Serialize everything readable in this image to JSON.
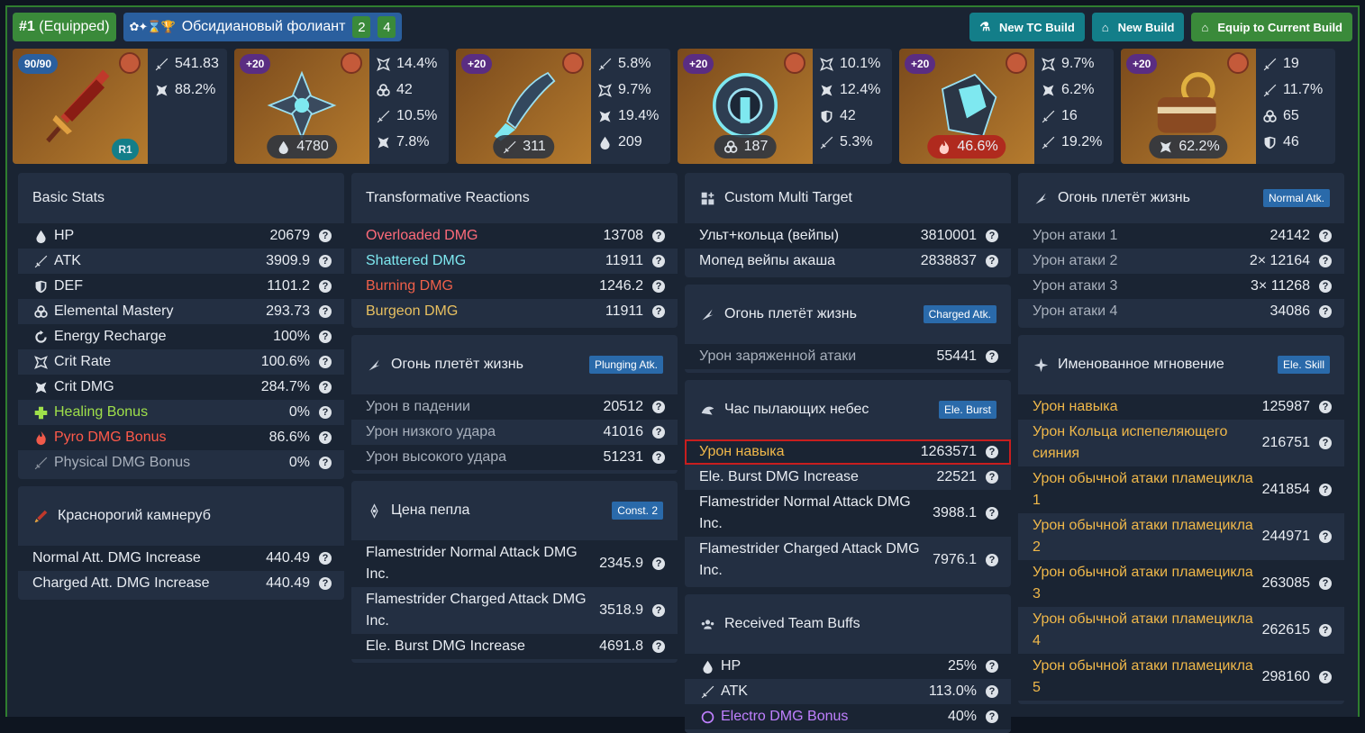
{
  "top": {
    "equip_num": "#1",
    "equip_label": "(Equipped)",
    "set_name": "Обсидиановый фолиант",
    "set_count_a": "2",
    "set_count_b": "4",
    "buttons": [
      "New TC Build",
      "New Build",
      "Equip to Current Build"
    ]
  },
  "items": [
    {
      "level": "90/90",
      "refine": "R1",
      "stats": [
        {
          "icon": "sword-icon",
          "val": "541.83"
        },
        {
          "icon": "crit-dmg-icon",
          "val": "88.2%"
        }
      ]
    },
    {
      "level": "+20",
      "main_icon": "hp-icon",
      "main": "4780",
      "stats": [
        {
          "icon": "crit-rate-icon",
          "val": "14.4%"
        },
        {
          "icon": "em-icon",
          "val": "42"
        },
        {
          "icon": "sword-icon",
          "val": "10.5%"
        },
        {
          "icon": "crit-dmg-icon",
          "val": "7.8%"
        }
      ]
    },
    {
      "level": "+20",
      "main_icon": "sword-icon",
      "main": "311",
      "stats": [
        {
          "icon": "sword-icon",
          "val": "5.8%"
        },
        {
          "icon": "crit-rate-icon",
          "val": "9.7%"
        },
        {
          "icon": "crit-dmg-icon",
          "val": "19.4%"
        },
        {
          "icon": "hp-icon",
          "val": "209"
        }
      ]
    },
    {
      "level": "+20",
      "main_icon": "em-icon",
      "main": "187",
      "stats": [
        {
          "icon": "crit-rate-icon",
          "val": "10.1%"
        },
        {
          "icon": "crit-dmg-icon",
          "val": "12.4%"
        },
        {
          "icon": "shield-icon",
          "val": "42"
        },
        {
          "icon": "sword-icon",
          "val": "5.3%"
        }
      ]
    },
    {
      "level": "+20",
      "main_icon": "pyro-icon",
      "main": "46.6%",
      "stats": [
        {
          "icon": "crit-rate-icon",
          "val": "9.7%"
        },
        {
          "icon": "crit-dmg-icon",
          "val": "6.2%"
        },
        {
          "icon": "sword-icon",
          "val": "16"
        },
        {
          "icon": "sword-icon",
          "val": "19.2%"
        }
      ]
    },
    {
      "level": "+20",
      "main_icon": "crit-dmg-icon",
      "main": "62.2%",
      "stats": [
        {
          "icon": "sword-icon",
          "val": "19"
        },
        {
          "icon": "sword-icon",
          "val": "11.7%"
        },
        {
          "icon": "em-icon",
          "val": "65"
        },
        {
          "icon": "shield-icon",
          "val": "46"
        }
      ]
    }
  ],
  "basic": {
    "title": "Basic Stats",
    "rows": [
      {
        "label": "HP",
        "value": "20679"
      },
      {
        "label": "ATK",
        "value": "3909.9"
      },
      {
        "label": "DEF",
        "value": "1101.2"
      },
      {
        "label": "Elemental Mastery",
        "value": "293.73"
      },
      {
        "label": "Energy Recharge",
        "value": "100%"
      },
      {
        "label": "Crit Rate",
        "value": "100.6%"
      },
      {
        "label": "Crit DMG",
        "value": "284.7%"
      },
      {
        "label": "Healing Bonus",
        "value": "0%"
      },
      {
        "label": "Pyro DMG Bonus",
        "value": "86.6%"
      },
      {
        "label": "Physical DMG Bonus",
        "value": "0%"
      }
    ]
  },
  "weapon_card": {
    "title": "Краснорогий камнеруб",
    "rows": [
      {
        "label": "Normal Att. DMG Increase",
        "value": "440.49"
      },
      {
        "label": "Charged Att. DMG Increase",
        "value": "440.49"
      }
    ]
  },
  "transform": {
    "title": "Transformative Reactions",
    "rows": [
      {
        "label": "Overloaded DMG",
        "value": "13708",
        "color": "#ff6b7a"
      },
      {
        "label": "Shattered DMG",
        "value": "11911",
        "color": "#7ee8f0"
      },
      {
        "label": "Burning DMG",
        "value": "1246.2",
        "color": "#f0604a"
      },
      {
        "label": "Burgeon DMG",
        "value": "11911",
        "color": "#e8c060"
      }
    ]
  },
  "plunge": {
    "title": "Огонь плетёт жизнь",
    "badge": "Plunging Atk.",
    "rows": [
      {
        "label": "Урон в падении",
        "value": "20512"
      },
      {
        "label": "Урон низкого удара",
        "value": "41016"
      },
      {
        "label": "Урон высокого удара",
        "value": "51231"
      }
    ]
  },
  "const2": {
    "title": "Цена пепла",
    "badge": "Const. 2",
    "rows": [
      {
        "label": "Flamestrider Normal Attack DMG Inc.",
        "value": "2345.9"
      },
      {
        "label": "Flamestrider Charged Attack DMG Inc.",
        "value": "3518.9"
      },
      {
        "label": "Ele. Burst DMG Increase",
        "value": "4691.8"
      }
    ]
  },
  "multi": {
    "title": "Custom Multi Target",
    "rows": [
      {
        "label": "Ульт+кольца (вейпы)",
        "value": "3810001"
      },
      {
        "label": "Мопед вейпы акаша",
        "value": "2838837"
      }
    ]
  },
  "charged": {
    "title": "Огонь плетёт жизнь",
    "badge": "Charged Atk.",
    "rows": [
      {
        "label": "Урон заряженной атаки",
        "value": "55441"
      }
    ]
  },
  "burst": {
    "title": "Час пылающих небес",
    "badge": "Ele. Burst",
    "rows": [
      {
        "label": "Урон навыка",
        "value": "1263571"
      },
      {
        "label": "Ele. Burst DMG Increase",
        "value": "22521"
      },
      {
        "label": "Flamestrider Normal Attack DMG Inc.",
        "value": "3988.1"
      },
      {
        "label": "Flamestrider Charged Attack DMG Inc.",
        "value": "7976.1"
      }
    ]
  },
  "team": {
    "title": "Received Team Buffs",
    "rows": [
      {
        "label": "HP",
        "value": "25%"
      },
      {
        "label": "ATK",
        "value": "113.0%"
      },
      {
        "label": "Electro DMG Bonus",
        "value": "40%"
      }
    ]
  },
  "normal": {
    "title": "Огонь плетёт жизнь",
    "badge": "Normal Atk.",
    "rows": [
      {
        "label": "Урон атаки 1",
        "value": "24142"
      },
      {
        "label": "Урон атаки 2",
        "value": "2× 12164"
      },
      {
        "label": "Урон атаки 3",
        "value": "3× 11268"
      },
      {
        "label": "Урон атаки 4",
        "value": "34086"
      }
    ]
  },
  "skill": {
    "title": "Именованное мгновение",
    "badge": "Ele. Skill",
    "rows": [
      {
        "label": "Урон навыка",
        "value": "125987"
      },
      {
        "label": "Урон Кольца испепеляющего сияния",
        "value": "216751"
      },
      {
        "label": "Урон обычной атаки пламецикла 1",
        "value": "241854"
      },
      {
        "label": "Урон обычной атаки пламецикла 2",
        "value": "244971"
      },
      {
        "label": "Урон обычной атаки пламецикла 3",
        "value": "263085"
      },
      {
        "label": "Урон обычной атаки пламецикла 4",
        "value": "262615"
      },
      {
        "label": "Урон обычной атаки пламецикла 5",
        "value": "298160"
      }
    ]
  },
  "colors": {
    "accent_green": "#3a8a3a",
    "teal": "#137e89",
    "highlight": "#c81e1e"
  }
}
